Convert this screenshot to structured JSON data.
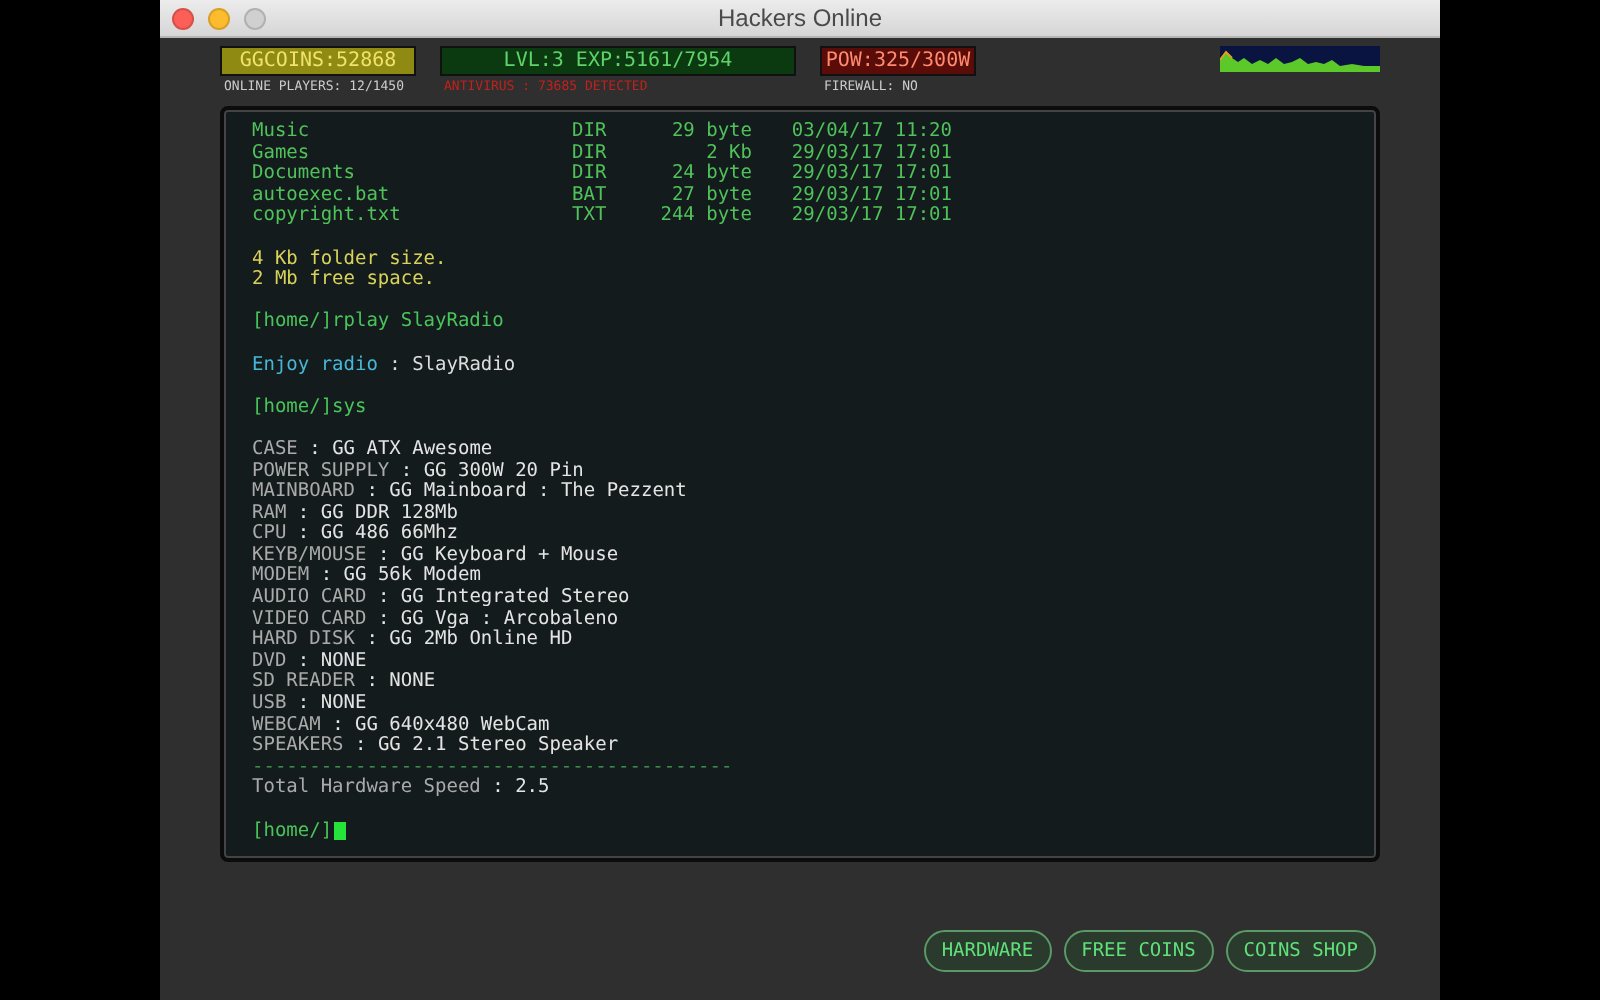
{
  "window": {
    "title": "Hackers Online"
  },
  "stats": {
    "coins": "GGCOINS:52868",
    "online": "ONLINE PLAYERS: 12/1450",
    "level": "LVL:3  EXP:5161/7954",
    "antivirus": "ANTIVIRUS : 73685 DETECTED",
    "power": "POW:325/300W",
    "firewall": "FIREWALL: NO"
  },
  "terminal": {
    "lines": [
      {
        "kind": "file",
        "name": "Music",
        "type": "DIR",
        "size": "29 byte",
        "date": "03/04/17 11:20"
      },
      {
        "kind": "file",
        "name": "Games",
        "type": "DIR",
        "size": "2 Kb",
        "date": "29/03/17 17:01"
      },
      {
        "kind": "file",
        "name": "Documents",
        "type": "DIR",
        "size": "24 byte",
        "date": "29/03/17 17:01"
      },
      {
        "kind": "file",
        "name": "autoexec.bat",
        "type": "BAT",
        "size": "27 byte",
        "date": "29/03/17 17:01"
      },
      {
        "kind": "file",
        "name": "copyright.txt",
        "type": "TXT",
        "size": "244 byte",
        "date": "29/03/17 17:01"
      },
      {
        "kind": "blank"
      },
      {
        "kind": "info",
        "text": "4 Kb folder size."
      },
      {
        "kind": "info",
        "text": "2 Mb free space."
      },
      {
        "kind": "blank"
      },
      {
        "kind": "prompt",
        "text": "[home/]rplay SlayRadio"
      },
      {
        "kind": "blank"
      },
      {
        "kind": "pair",
        "label": "Enjoy radio",
        "value": ": SlayRadio"
      },
      {
        "kind": "blank"
      },
      {
        "kind": "prompt",
        "text": "[home/]sys"
      },
      {
        "kind": "blank"
      },
      {
        "kind": "spec",
        "label": "CASE",
        "value": ": GG ATX Awesome"
      },
      {
        "kind": "spec",
        "label": "POWER SUPPLY",
        "value": ": GG 300W 20 Pin"
      },
      {
        "kind": "spec",
        "label": "MAINBOARD",
        "value": ": GG Mainboard : The Pezzent"
      },
      {
        "kind": "spec",
        "label": "RAM",
        "value": ": GG DDR 128Mb"
      },
      {
        "kind": "spec",
        "label": "CPU",
        "value": ": GG 486 66Mhz"
      },
      {
        "kind": "spec",
        "label": "KEYB/MOUSE",
        "value": ": GG Keyboard + Mouse"
      },
      {
        "kind": "spec",
        "label": "MODEM",
        "value": ": GG 56k Modem"
      },
      {
        "kind": "spec",
        "label": "AUDIO CARD",
        "value": ": GG Integrated Stereo"
      },
      {
        "kind": "spec",
        "label": "VIDEO CARD",
        "value": ": GG Vga : Arcobaleno"
      },
      {
        "kind": "spec",
        "label": "HARD DISK",
        "value": ": GG 2Mb Online HD"
      },
      {
        "kind": "spec",
        "label": "DVD",
        "value": ": NONE"
      },
      {
        "kind": "spec",
        "label": "SD READER",
        "value": ": NONE"
      },
      {
        "kind": "spec",
        "label": "USB",
        "value": ": NONE"
      },
      {
        "kind": "spec",
        "label": "WEBCAM",
        "value": ": GG 640x480 WebCam"
      },
      {
        "kind": "spec",
        "label": "SPEAKERS",
        "value": ": GG 2.1 Stereo Speaker"
      },
      {
        "kind": "divider",
        "text": "------------------------------------------"
      },
      {
        "kind": "spec",
        "label": "Total Hardware Speed",
        "value": ": 2.5"
      },
      {
        "kind": "blank"
      },
      {
        "kind": "input",
        "text": "[home/]"
      }
    ]
  },
  "buttons": [
    "HARDWARE",
    "FREE COINS",
    "COINS SHOP"
  ]
}
